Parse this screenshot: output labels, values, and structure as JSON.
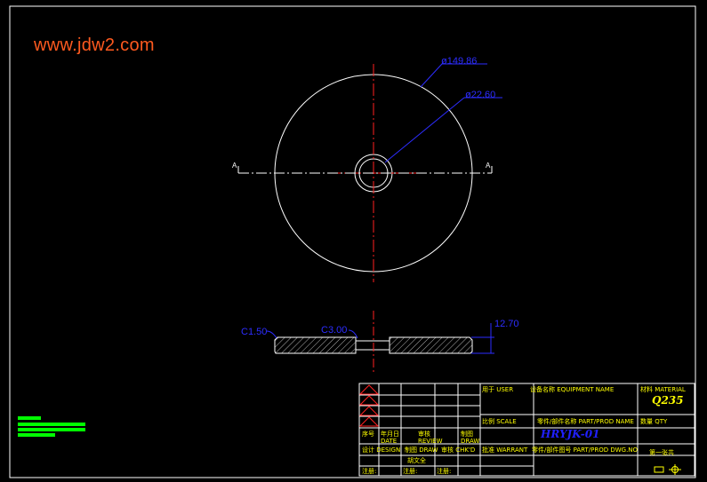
{
  "watermark": "www.jdw2.com",
  "dimensions": {
    "outer_diameter": "ø149.86",
    "inner_diameter": "ø22.60",
    "chamfer_left": "C1.50",
    "chamfer_right": "C3.00",
    "thickness": "12.70"
  },
  "section": {
    "left": "A",
    "right": "A"
  },
  "title_block": {
    "usage_label": "用于  USER",
    "equipment_label": "设备名称  EQUIPMENT NAME",
    "material_label": "材料 MATERIAL",
    "material_value": "Q235",
    "scale_label": "比例 SCALE",
    "part_name_label": "零件/部件名称 PART/PROD NAME",
    "qty_label": "数量 QTY",
    "sequence_label": "序号",
    "date_label": "年月日 DATE",
    "review_label": "审核 REVIEW",
    "draw_label": "制图 DRAW",
    "drawing_number": "HRYJK-01",
    "design_label": "设计 DESIGN",
    "drawn_label": "制图 DRAW",
    "checked_label": "审核 CHK'D",
    "approve_label": "批准 WARRANT",
    "drawing_no_label": "零件/部件图号 PART/PROD DWG.NO",
    "sheet_label": "第一张共",
    "remark1": "注册:",
    "remark2": "注册:",
    "remark3": "注册:",
    "signature_name": "胡文全"
  },
  "colors": {
    "outline": "#ffffff",
    "centerline": "#ff2020",
    "dimension": "#2d2dff",
    "titleblock_frame": "#ffffff",
    "titleblock_text": "#ffff00",
    "accent_green": "#00ff00",
    "watermark": "#ff5a1f"
  }
}
